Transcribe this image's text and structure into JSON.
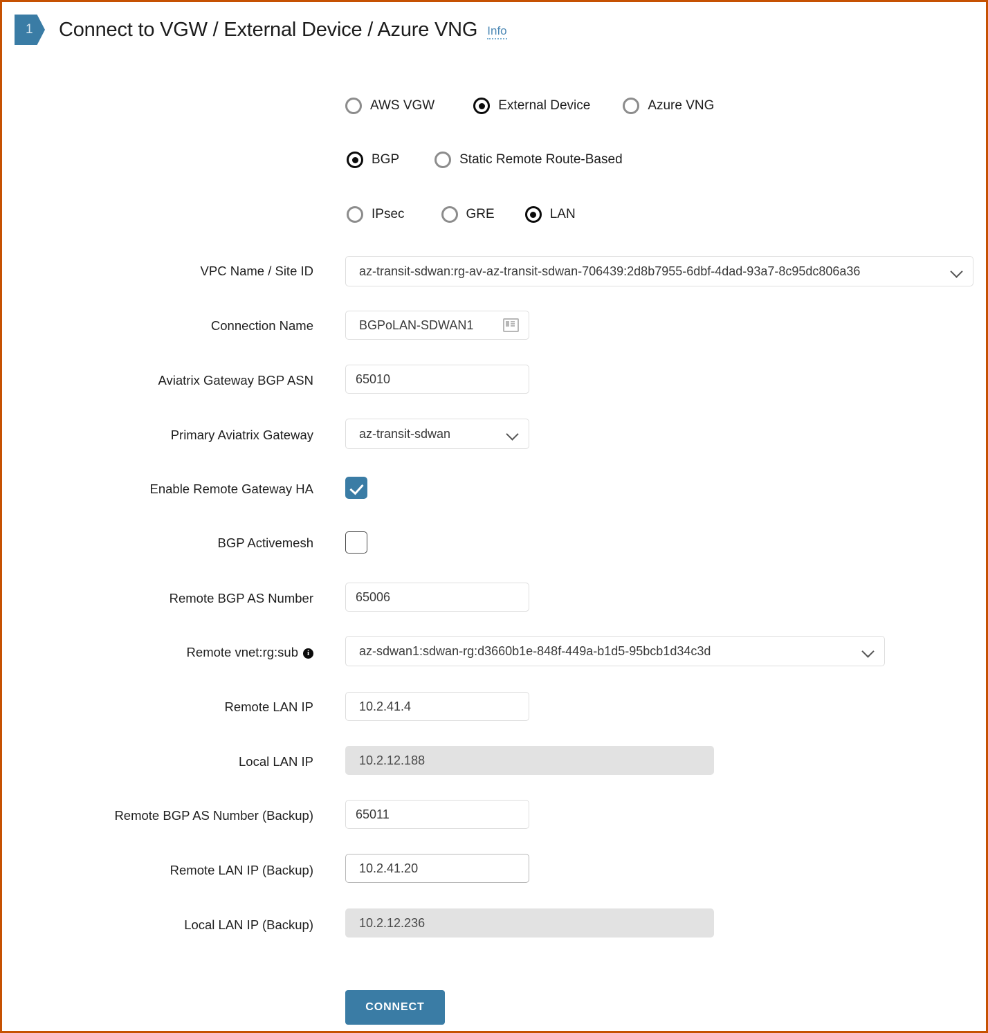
{
  "header": {
    "step_number": "1",
    "title": "Connect to VGW / External Device / Azure VNG",
    "info_link": "Info"
  },
  "radio_groups": [
    {
      "name": "target-type",
      "options": [
        {
          "label": "AWS VGW",
          "selected": false
        },
        {
          "label": "External Device",
          "selected": true
        },
        {
          "label": "Azure VNG",
          "selected": false
        }
      ]
    },
    {
      "name": "routing-type",
      "options": [
        {
          "label": "BGP",
          "selected": true
        },
        {
          "label": "Static Remote Route-Based",
          "selected": false
        }
      ]
    },
    {
      "name": "tunnel-type",
      "options": [
        {
          "label": "IPsec",
          "selected": false
        },
        {
          "label": "GRE",
          "selected": false
        },
        {
          "label": "LAN",
          "selected": true
        }
      ]
    }
  ],
  "fields": {
    "vpc_name_site_id": {
      "label": "VPC Name / Site ID",
      "value": "az-transit-sdwan:rg-av-az-transit-sdwan-706439:2d8b7955-6dbf-4dad-93a7-8c95dc806a36"
    },
    "connection_name": {
      "label": "Connection Name",
      "value": "BGPoLAN-SDWAN1"
    },
    "aviatrix_gateway_bgp_asn": {
      "label": "Aviatrix Gateway BGP ASN",
      "value": "65010"
    },
    "primary_aviatrix_gateway": {
      "label": "Primary Aviatrix Gateway",
      "value": "az-transit-sdwan"
    },
    "enable_remote_gateway_ha": {
      "label": "Enable Remote Gateway HA",
      "checked": true
    },
    "bgp_activemesh": {
      "label": "BGP Activemesh",
      "checked": false
    },
    "remote_bgp_as_number": {
      "label": "Remote BGP AS Number",
      "value": "65006"
    },
    "remote_vnet_rg_sub": {
      "label": "Remote vnet:rg:sub",
      "value": "az-sdwan1:sdwan-rg:d3660b1e-848f-449a-b1d5-95bcb1d34c3d",
      "has_info_icon": true
    },
    "remote_lan_ip": {
      "label": "Remote LAN IP",
      "value": "10.2.41.4"
    },
    "local_lan_ip": {
      "label": "Local LAN IP",
      "value": "10.2.12.188",
      "readonly": true
    },
    "remote_bgp_as_number_backup": {
      "label": "Remote BGP AS Number (Backup)",
      "value": "65011"
    },
    "remote_lan_ip_backup": {
      "label": "Remote LAN IP (Backup)",
      "value": "10.2.41.20"
    },
    "local_lan_ip_backup": {
      "label": "Local LAN IP (Backup)",
      "value": "10.2.12.236",
      "readonly": true
    }
  },
  "actions": {
    "connect_label": "CONNECT"
  },
  "colors": {
    "accent_blue": "#3a7ca5",
    "border_orange": "#c65102",
    "link_blue": "#4c88b5",
    "readonly_bg": "#e2e2e2"
  }
}
